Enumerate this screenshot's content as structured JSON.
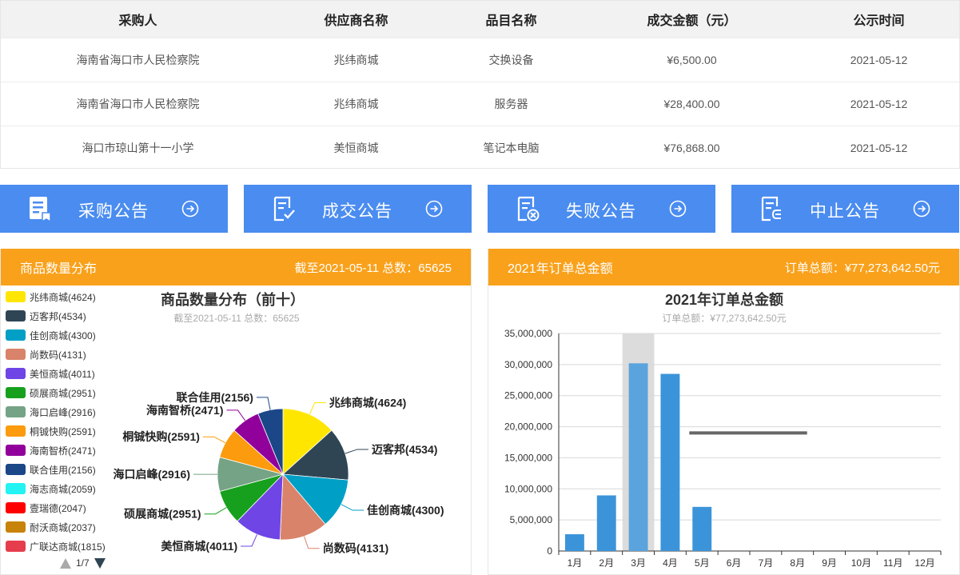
{
  "table": {
    "headers": [
      "采购人",
      "供应商名称",
      "品目名称",
      "成交金额（元）",
      "公示时间"
    ],
    "rows": [
      [
        "海南省海口市人民检察院",
        "兆纬商城",
        "交换设备",
        "¥6,500.00",
        "2021-05-12"
      ],
      [
        "海南省海口市人民检察院",
        "兆纬商城",
        "服务器",
        "¥28,400.00",
        "2021-05-12"
      ],
      [
        "海口市琼山第十一小学",
        "美恒商城",
        "笔记本电脑",
        "¥76,868.00",
        "2021-05-12"
      ]
    ]
  },
  "buttons": [
    {
      "label": "采购公告",
      "icon": "document-edit-icon"
    },
    {
      "label": "成交公告",
      "icon": "document-check-icon"
    },
    {
      "label": "失败公告",
      "icon": "document-close-icon"
    },
    {
      "label": "中止公告",
      "icon": "document-stop-icon"
    }
  ],
  "left_panel": {
    "title": "商品数量分布",
    "info": "截至2021-05-11 总数：65625",
    "pager": "1/7"
  },
  "right_panel": {
    "title": "2021年订单总金额",
    "info": "订单总额：¥77,273,642.50元"
  },
  "colors": {
    "accent_blue": "#4a8cf0",
    "panel_orange": "#f9a11b",
    "bar_blue": "#3b94d9"
  },
  "chart_data": [
    {
      "type": "pie",
      "title": "商品数量分布（前十）",
      "subtitle": "截至2021-05-11 总数：65625",
      "legend_position": "left",
      "legend": [
        {
          "name": "兆纬商城(4624)",
          "color": "#ffe600"
        },
        {
          "name": "迈客邦(4534)",
          "color": "#2f4554"
        },
        {
          "name": "佳创商城(4300)",
          "color": "#009fc6"
        },
        {
          "name": "尚数码(4131)",
          "color": "#d9836a"
        },
        {
          "name": "美恒商城(4011)",
          "color": "#6f45e6"
        },
        {
          "name": "硕展商城(2951)",
          "color": "#17a01d"
        },
        {
          "name": "海口启峰(2916)",
          "color": "#75a385"
        },
        {
          "name": "桐铖快购(2591)",
          "color": "#fb9b0d"
        },
        {
          "name": "海南智桥(2471)",
          "color": "#91009b"
        },
        {
          "name": "联合佳用(2156)",
          "color": "#1b4788"
        },
        {
          "name": "海志商城(2059)",
          "color": "#23f3f3"
        },
        {
          "name": "壹瑞德(2047)",
          "color": "#ff0000"
        },
        {
          "name": "耐沃商城(2037)",
          "color": "#c7830a"
        },
        {
          "name": "广联达商城(1815)",
          "color": "#e63d4c"
        }
      ],
      "slices": [
        {
          "name": "兆纬商城",
          "value": 4624,
          "label": "兆纬商城(4624)",
          "color": "#ffe600"
        },
        {
          "name": "迈客邦",
          "value": 4534,
          "label": "迈客邦(4534)",
          "color": "#2f4554"
        },
        {
          "name": "佳创商城",
          "value": 4300,
          "label": "佳创商城(4300)",
          "color": "#009fc6"
        },
        {
          "name": "尚数码",
          "value": 4131,
          "label": "尚数码(4131)",
          "color": "#d9836a"
        },
        {
          "name": "美恒商城",
          "value": 4011,
          "label": "美恒商城(4011)",
          "color": "#6f45e6"
        },
        {
          "name": "硕展商城",
          "value": 2951,
          "label": "硕展商城(2951)",
          "color": "#17a01d"
        },
        {
          "name": "海口启峰",
          "value": 2916,
          "label": "海口启峰(2916)",
          "color": "#75a385"
        },
        {
          "name": "桐铖快购",
          "value": 2591,
          "label": "桐铖快购(2591)",
          "color": "#fb9b0d"
        },
        {
          "name": "海南智桥",
          "value": 2471,
          "label": "海南智桥(2471)",
          "color": "#91009b"
        },
        {
          "name": "联合佳用",
          "value": 2156,
          "label": "联合佳用(2156)",
          "color": "#1b4788"
        }
      ]
    },
    {
      "type": "bar",
      "title": "2021年订单总金额",
      "subtitle": "订单总额：¥77,273,642.50元",
      "categories": [
        "1月",
        "2月",
        "3月",
        "4月",
        "5月",
        "6月",
        "7月",
        "8月",
        "9月",
        "10月",
        "11月",
        "12月"
      ],
      "values": [
        2700000,
        8950000,
        30200000,
        28500000,
        7100000,
        0,
        0,
        0,
        0,
        0,
        0,
        0
      ],
      "ylim": [
        0,
        35000000
      ],
      "yticks": [
        "0",
        "5,000,000",
        "10,000,000",
        "15,000,000",
        "20,000,000",
        "25,000,000",
        "30,000,000",
        "35,000,000"
      ],
      "highlighted_category": "3月",
      "tooltip_line_y": 19000000,
      "grid": true
    }
  ]
}
